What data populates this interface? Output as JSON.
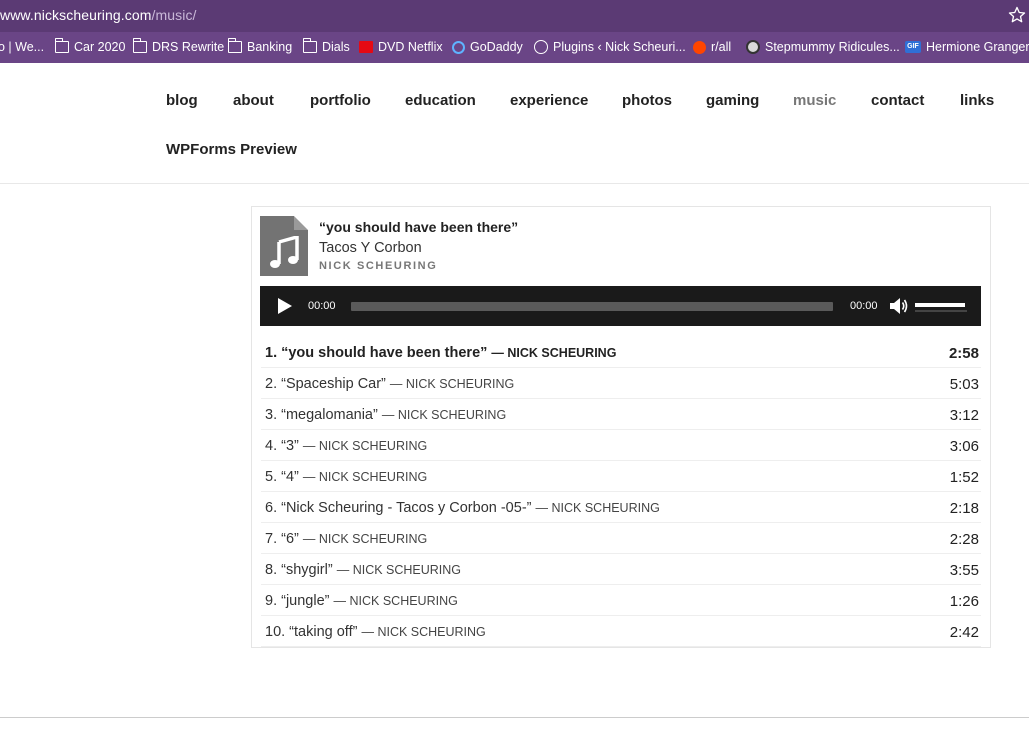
{
  "browser": {
    "url_host": "www.nickscheuring.com",
    "url_path": "/music/",
    "bookmarks": [
      {
        "label": "o | We...",
        "icon": "none"
      },
      {
        "label": "Car 2020",
        "icon": "folder-icon"
      },
      {
        "label": "DRS Rewrite",
        "icon": "folder-icon"
      },
      {
        "label": "Banking",
        "icon": "folder-icon"
      },
      {
        "label": "Dials",
        "icon": "folder-icon"
      },
      {
        "label": "DVD Netflix",
        "icon": "netflix-icon"
      },
      {
        "label": "GoDaddy",
        "icon": "godaddy-icon"
      },
      {
        "label": "Plugins ‹ Nick Scheuri...",
        "icon": "globe-icon"
      },
      {
        "label": "r/all",
        "icon": "reddit-icon"
      },
      {
        "label": "Stepmummy Ridicules...",
        "icon": "panda-icon"
      },
      {
        "label": "Hermione Granger",
        "icon": "gif-icon"
      }
    ]
  },
  "nav": {
    "items": [
      {
        "label": "blog"
      },
      {
        "label": "about"
      },
      {
        "label": "portfolio"
      },
      {
        "label": "education"
      },
      {
        "label": "experience"
      },
      {
        "label": "photos"
      },
      {
        "label": "gaming"
      },
      {
        "label": "music",
        "active": true
      },
      {
        "label": "contact"
      },
      {
        "label": "links"
      },
      {
        "label": "WPForms Preview"
      }
    ]
  },
  "now_playing": {
    "title": "“you should have been there”",
    "album": "Tacos Y Corbon",
    "artist": "NICK SCHEURING"
  },
  "player": {
    "current_time": "00:00",
    "duration": "00:00",
    "progress": 0,
    "volume": 0.8
  },
  "tracks": [
    {
      "name": "1. “you should have been there”",
      "artist": "— NICK SCHEURING",
      "length": "2:58",
      "current": true
    },
    {
      "name": "2. “Spaceship Car”",
      "artist": "— NICK SCHEURING",
      "length": "5:03"
    },
    {
      "name": "3. “megalomania”",
      "artist": "— NICK SCHEURING",
      "length": "3:12"
    },
    {
      "name": "4. “3”",
      "artist": "— NICK SCHEURING",
      "length": "3:06"
    },
    {
      "name": "5. “4”",
      "artist": "— NICK SCHEURING",
      "length": "1:52"
    },
    {
      "name": "6. “Nick Scheuring - Tacos y Corbon -05-”",
      "artist": "— NICK SCHEURING",
      "length": "2:18"
    },
    {
      "name": "7. “6”",
      "artist": "— NICK SCHEURING",
      "length": "2:28"
    },
    {
      "name": "8. “shygirl”",
      "artist": "— NICK SCHEURING",
      "length": "3:55"
    },
    {
      "name": "9. “jungle”",
      "artist": "— NICK SCHEURING",
      "length": "1:26"
    },
    {
      "name": "10. “taking off”",
      "artist": "— NICK SCHEURING",
      "length": "2:42"
    }
  ],
  "colors": {
    "chrome_url_bg": "#5b3a74",
    "chrome_bookmarks_bg": "#6a4586",
    "player_bg": "#1a1a1a"
  }
}
